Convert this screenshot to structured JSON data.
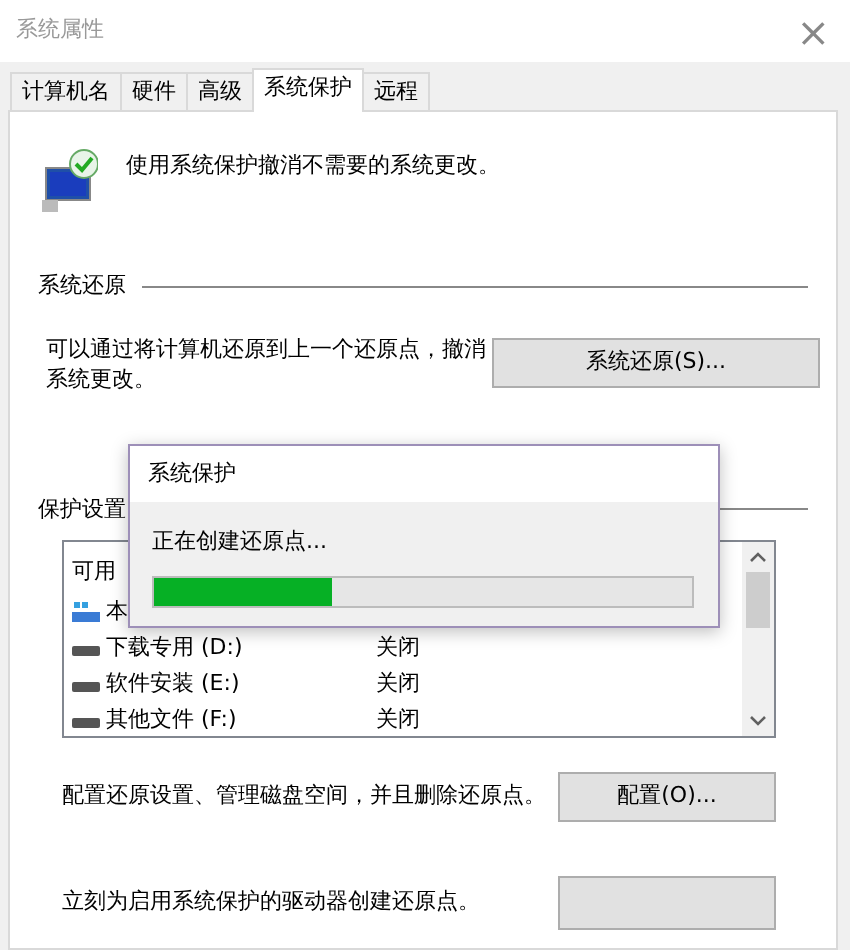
{
  "window": {
    "title": "系统属性",
    "close": "×"
  },
  "tabs": [
    {
      "label": "计算机名",
      "selected": false
    },
    {
      "label": "硬件",
      "selected": false
    },
    {
      "label": "高级",
      "selected": false
    },
    {
      "label": "系统保护",
      "selected": true
    },
    {
      "label": "远程",
      "selected": false
    }
  ],
  "intro": "使用系统保护撤消不需要的系统更改。",
  "system_restore": {
    "heading": "系统还原",
    "text": "可以通过将计算机还原到上一个还原点，撤消系统更改。",
    "button": "系统还原(S)..."
  },
  "protection_settings": {
    "heading": "保护设置",
    "list_header": "可用",
    "rows": [
      {
        "kind": "system",
        "name": "本"
      },
      {
        "kind": "drive",
        "name": "下载专用 (D:)",
        "status": "关闭"
      },
      {
        "kind": "drive",
        "name": "软件安装 (E:)",
        "status": "关闭"
      },
      {
        "kind": "drive",
        "name": "其他文件 (F:)",
        "status": "关闭"
      }
    ]
  },
  "configure": {
    "text": "配置还原设置、管理磁盘空间，并且删除还原点。",
    "button": "配置(O)..."
  },
  "create": {
    "text": "立刻为启用系统保护的驱动器创建还原点。"
  },
  "progress_dialog": {
    "title": "系统保护",
    "message": "正在创建还原点...",
    "level": 0.33
  }
}
